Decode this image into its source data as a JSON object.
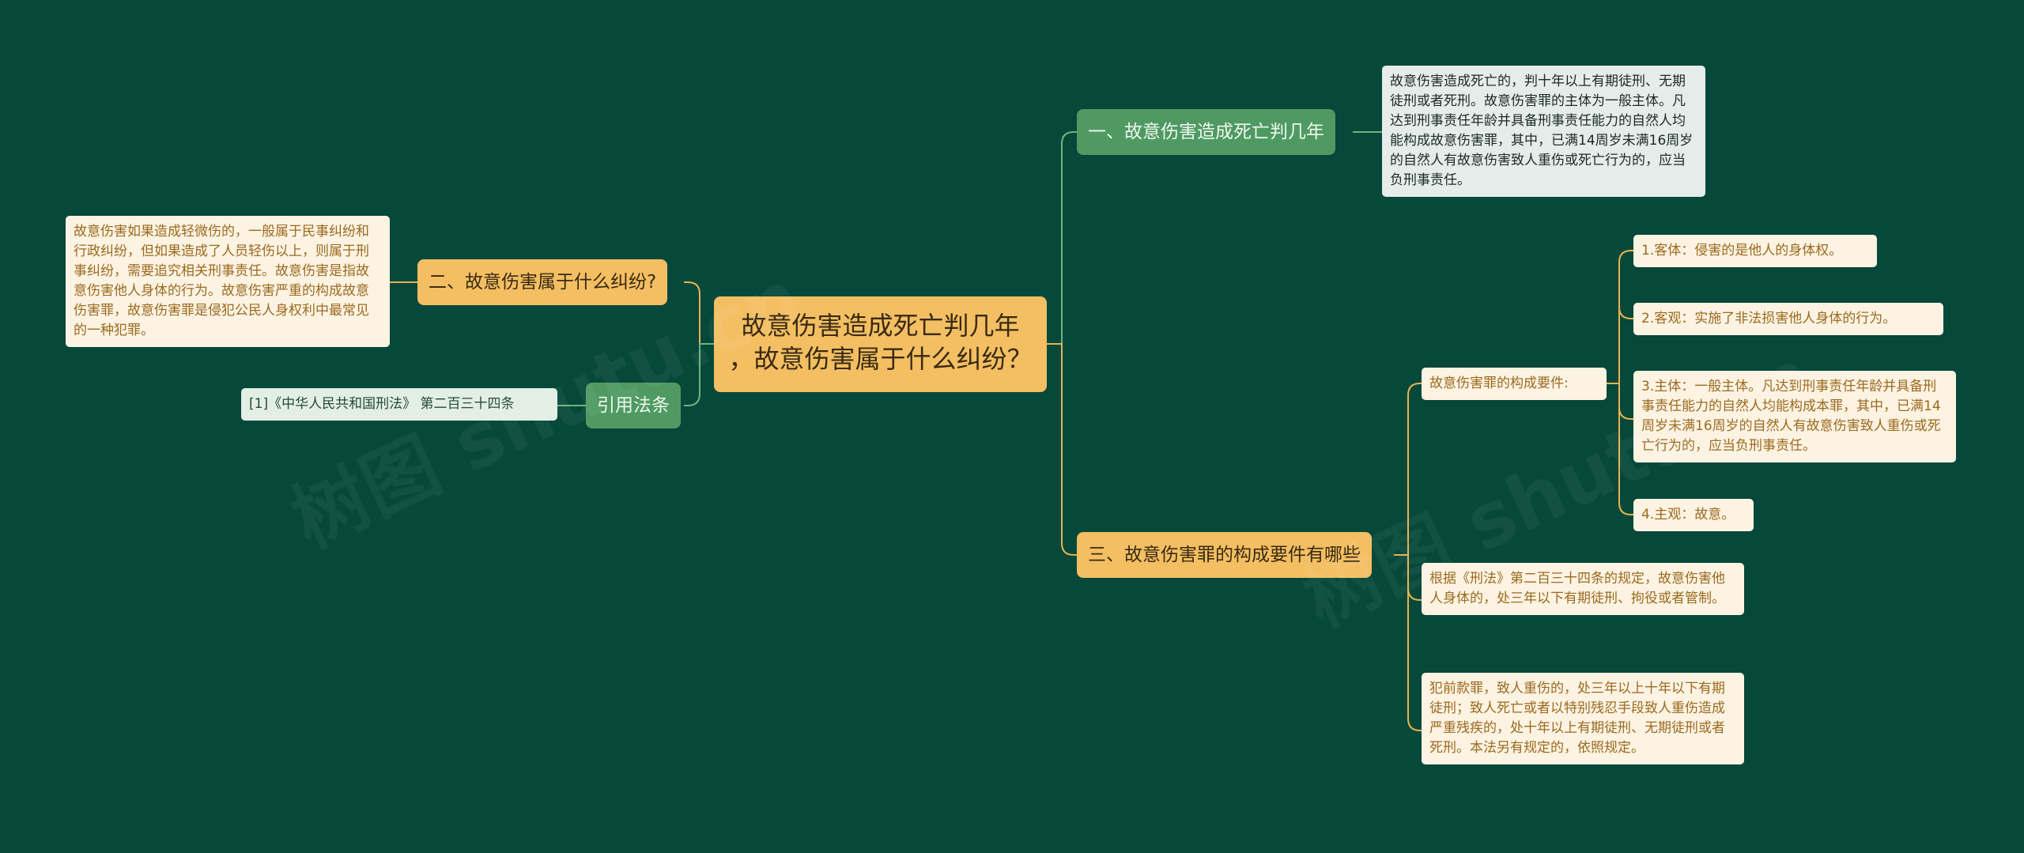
{
  "root": {
    "line1": "故意伤害造成死亡判几年",
    "line2": "，故意伤害属于什么纠纷？"
  },
  "branches": {
    "death_sentence": {
      "label": "一、故意伤害造成死亡判几年",
      "detail": "故意伤害造成死亡的，判十年以上有期徒刑、无期徒刑或者死刑。故意伤害罪的主体为一般主体。凡达到刑事责任年龄并具备刑事责任能力的自然人均能构成故意伤害罪，其中，已满14周岁未满16周岁的自然人有故意伤害致人重伤或死亡行为的，应当负刑事责任。"
    },
    "dispute_type": {
      "label": "二、故意伤害属于什么纠纷?",
      "detail": "故意伤害如果造成轻微伤的，一般属于民事纠纷和行政纠纷，但如果造成了人员轻伤以上，则属于刑事纠纷，需要追究相关刑事责任。故意伤害是指故意伤害他人身体的行为。故意伤害严重的构成故意伤害罪，故意伤害罪是侵犯公民人身权利中最常见的一种犯罪。"
    },
    "elements": {
      "label": "三、故意伤害罪的构成要件有哪些",
      "sub_label": "故意伤害罪的构成要件:",
      "items": [
        "1.客体：侵害的是他人的身体权。",
        "2.客观：实施了非法损害他人身体的行为。",
        "3.主体：一般主体。凡达到刑事责任年龄并具备刑事责任能力的自然人均能构成本罪，其中，已满14周岁未满16周岁的自然人有故意伤害致人重伤或死亡行为的，应当负刑事责任。",
        "4.主观：故意。"
      ],
      "law_text": "根据《刑法》第二百三十四条的规定，故意伤害他人身体的，处三年以下有期徒刑、拘役或者管制。",
      "penalty_text": "犯前款罪，致人重伤的，处三年以上十年以下有期徒刑；致人死亡或者以特别残忍手段致人重伤造成严重残疾的，处十年以上有期徒刑、无期徒刑或者死刑。本法另有规定的，依照规定。"
    },
    "citation": {
      "label": "引用法条",
      "detail": "[1]《中华人民共和国刑法》 第二百三十四条"
    }
  },
  "watermarks": [
    "树图 shutu.cn",
    "树图 shutu.cn"
  ],
  "colors": {
    "background": "#06483a",
    "orange_node": "#f3bf62",
    "green_node": "#4f9a62",
    "connector_green": "#6fb57e",
    "connector_orange": "#e7b24e",
    "detail_bg": "#fdf3e3"
  }
}
